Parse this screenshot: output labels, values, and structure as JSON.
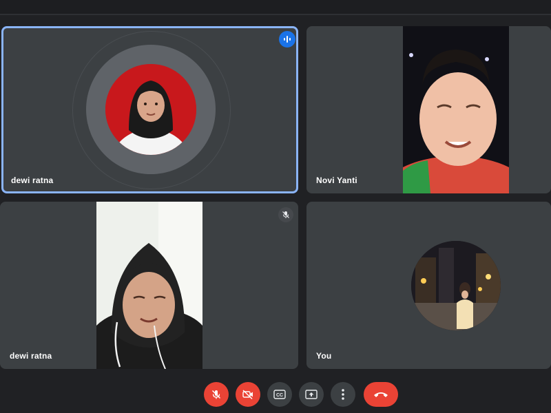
{
  "participants": [
    {
      "name": "dewi ratna",
      "state": "speaking"
    },
    {
      "name": "Novi Yanti",
      "state": "video"
    },
    {
      "name": "dewi ratna",
      "state": "muted"
    },
    {
      "name": "You",
      "state": "camera-off"
    }
  ],
  "controls": [
    {
      "icon": "mic-off-icon",
      "state": "off"
    },
    {
      "icon": "camera-off-icon",
      "state": "off"
    },
    {
      "icon": "captions-icon",
      "label": "CC"
    },
    {
      "icon": "present-screen-icon"
    },
    {
      "icon": "more-options-icon"
    },
    {
      "icon": "hang-up-icon"
    }
  ],
  "colors": {
    "background": "#202124",
    "tile": "#3c4043",
    "active_border": "#8ab4f8",
    "danger": "#ea4335",
    "speaking": "#1a73e8"
  }
}
